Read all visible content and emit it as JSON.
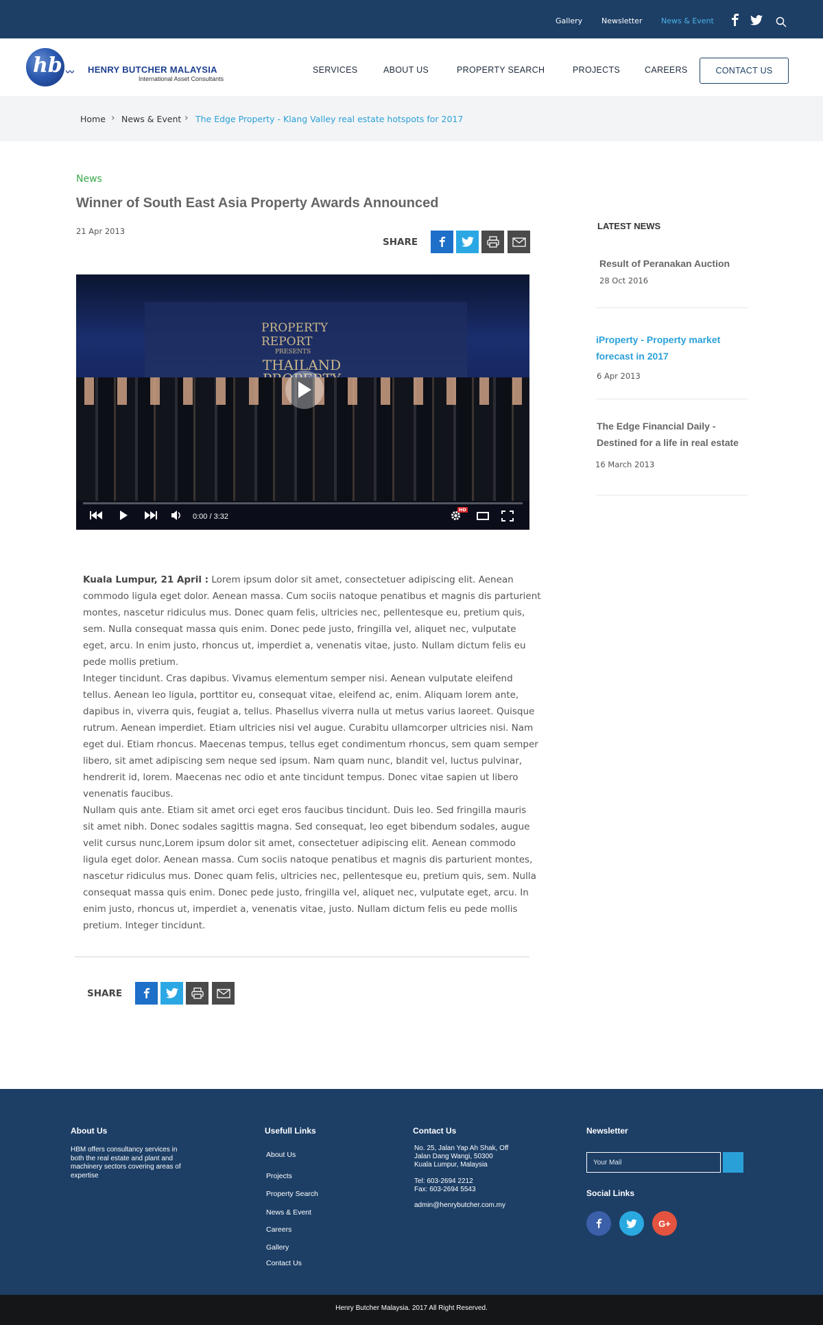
{
  "topbar": {
    "links": [
      "Gallery",
      "Newsletter",
      "News & Event"
    ],
    "active_link": "News & Event",
    "icons": [
      "facebook-icon",
      "twitter-icon",
      "search-icon"
    ]
  },
  "brand": {
    "logo_initials": "hb",
    "name": "HENRY BUTCHER MALAYSIA",
    "tagline": "International Asset Consultants",
    "colors": {
      "primary": "#1d3f66",
      "accent": "#2aa0d8",
      "category": "#3aa84b"
    }
  },
  "nav": {
    "items": [
      "SERVICES",
      "ABOUT US",
      "PROPERTY SEARCH",
      "PROJECTS",
      "CAREERS"
    ],
    "contact_button": "CONTACT US"
  },
  "breadcrumb": {
    "items": [
      "Home",
      "News & Event",
      "The Edge Property - Klang Valley real estate hotspots for 2017"
    ]
  },
  "article": {
    "category": "News",
    "title": "Winner of South East Asia Property Awards Announced",
    "date": "21 Apr 2013",
    "share_label": "SHARE",
    "share_icons": [
      "facebook-icon",
      "twitter-icon",
      "print-icon",
      "mail-icon"
    ],
    "video": {
      "banner_line1": "PROPERTY",
      "banner_line2": "REPORT",
      "banner_line3": "PRESENTS",
      "banner_line4": "THAILAND PROPERTY AWARDS",
      "time": "0:00 / 3:32",
      "hd_badge": "HD",
      "progress": 0
    },
    "lead": "Kuala Lumpur, 21 April :",
    "paragraph1": "Lorem ipsum dolor sit amet, consectetuer adipiscing elit. Aenean commodo ligula eget dolor. Aenean  massa. Cum sociis natoque penatibus et magnis dis parturient montes, nascetur ridiculus mus. Donec quam felis, ultricies nec, pellentesque eu, pretium quis, sem. Nulla consequat massa quis enim. Donec pede justo, fringilla vel, aliquet nec, vulputate eget, arcu. In enim justo, rhoncus ut, imperdiet a, venenatis vitae, justo. Nullam dictum felis eu pede mollis pretium.",
    "paragraph2": "Integer tincidunt. Cras dapibus. Vivamus elementum semper nisi. Aenean vulputate eleifend tellus. Aenean leo ligula, porttitor eu, consequat vitae, eleifend ac, enim. Aliquam lorem ante, dapibus in, viverra quis, feugiat a, tellus. Phasellus viverra nulla ut metus varius laoreet. Quisque rutrum. Aenean imperdiet. Etiam ultricies nisi vel augue. Curabitu ullamcorper ultricies nisi. Nam eget dui. Etiam rhoncus. Maecenas tempus, tellus eget condimentum rhoncus, sem quam semper libero, sit amet adipiscing sem neque sed ipsum. Nam quam nunc, blandit vel, luctus pulvinar, hendrerit id, lorem. Maecenas nec odio et ante tincidunt tempus. Donec vitae sapien ut libero venenatis faucibus.",
    "paragraph3": "Nullam quis ante. Etiam sit amet orci eget eros faucibus tincidunt. Duis leo. Sed fringilla mauris sit amet nibh. Donec sodales sagittis magna. Sed consequat, leo eget bibendum sodales, augue velit cursus nunc,Lorem ipsum dolor sit amet, consectetuer adipiscing elit. Aenean commodo ligula eget dolor. Aenean massa. Cum sociis natoque penatibus et magnis dis parturient montes, nascetur ridiculus mus. Donec quam felis, ultricies nec, pellentesque eu, pretium quis, sem. Nulla consequat massa quis enim. Donec pede justo, fringilla vel, aliquet nec, vulputate eget, arcu. In enim justo, rhoncus ut, imperdiet a, venenatis vitae, justo. Nullam dictum felis eu pede mollis pretium. Integer tincidunt."
  },
  "sidebar": {
    "heading": "LATEST NEWS",
    "items": [
      {
        "title": "Result of Peranakan Auction",
        "date": "28 Oct 2016"
      },
      {
        "title": "iProperty - Property market forecast in 2017",
        "date": "6 Apr 2013"
      },
      {
        "title": "The Edge Financial Daily - Destined for a life in real estate",
        "date": "16 March 2013"
      }
    ]
  },
  "footer": {
    "about_heading": "About Us",
    "about_text": "HBM offers consultancy services in both the real estate and plant and machinery sectors covering areas of expertise",
    "links_heading": "Usefull Links",
    "links": [
      "About Us",
      "Projects",
      "Property Search",
      "News & Event",
      "Careers",
      "Gallery",
      "Contact Us"
    ],
    "contact_heading": "Contact Us",
    "address": [
      "No. 25, Jalan Yap Ah Shak, Off",
      "Jalan Dang Wangi, 50300",
      "Kuala Lumpur, Malaysia"
    ],
    "tel": "Tel: 603-2694 2212",
    "fax": "Fax: 603-2694 5543",
    "email": "admin@henrybutcher.com.my",
    "newsletter_heading": "Newsletter",
    "newsletter_placeholder": "Your Mail",
    "social_heading": "Social Links",
    "social": [
      {
        "icon": "facebook-icon",
        "glyph": "f",
        "color": "#3b5fa8"
      },
      {
        "icon": "twitter-icon",
        "glyph": "t",
        "color": "#2aa9e0"
      },
      {
        "icon": "google-plus-icon",
        "glyph": "G+",
        "color": "#e4533f"
      }
    ],
    "copyright": "Henry Butcher Malaysia. 2017 All Right Reserved."
  }
}
